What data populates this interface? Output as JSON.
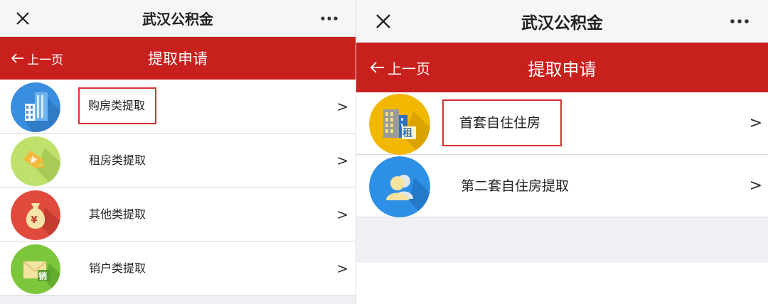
{
  "left": {
    "window_title": "武汉公积金",
    "back_label": "上一页",
    "page_title": "提取申请",
    "items": [
      {
        "label": "购房类提取",
        "chevron": ">",
        "icon": "building-icon",
        "highlighted": true
      },
      {
        "label": "租房类提取",
        "chevron": ">",
        "icon": "yuan-tag-icon",
        "highlighted": false
      },
      {
        "label": "其他类提取",
        "chevron": ">",
        "icon": "money-bag-icon",
        "highlighted": false
      },
      {
        "label": "销户类提取",
        "chevron": ">",
        "icon": "closing-account-envelope-icon",
        "highlighted": false
      }
    ]
  },
  "right": {
    "window_title": "武汉公积金",
    "back_label": "上一页",
    "page_title": "提取申请",
    "items": [
      {
        "label": "首套自住住房",
        "chevron": ">",
        "icon": "rental-building-icon",
        "highlighted": true
      },
      {
        "label": "第二套自住房提取",
        "chevron": ">",
        "icon": "user-silhouette-icon",
        "highlighted": false
      }
    ]
  },
  "icon_texts": {
    "yuan": "¥",
    "xiao": "销",
    "zu": "租"
  },
  "colors": {
    "red_header": "#c8201d",
    "highlight_box": "#d93030",
    "building_icon_bg": "#3a8ee0",
    "tag_icon_bg": "#bfe06a",
    "bag_icon_bg": "#e04a3c",
    "envelope_icon_bg": "#7cc63c",
    "rental_icon_bg": "#f2b800",
    "user_icon_bg": "#2d8fe6"
  }
}
